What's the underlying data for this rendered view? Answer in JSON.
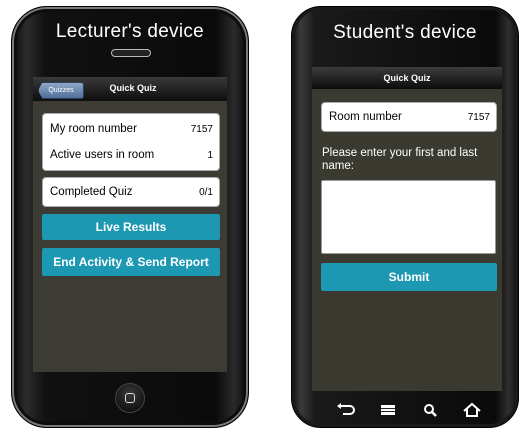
{
  "lecturer": {
    "caption": "Lecturer's device",
    "nav_back": "Quizzes",
    "nav_title": "Quick Quiz",
    "room_label": "My room number",
    "room_value": "7157",
    "active_label": "Active users in room",
    "active_value": "1",
    "completed_label": "Completed Quiz",
    "completed_value": "0/1",
    "live_results_button": "Live Results",
    "end_activity_button": "End Activity & Send Report"
  },
  "student": {
    "caption": "Student's device",
    "nav_title": "Quick Quiz",
    "room_label": "Room number",
    "room_value": "7157",
    "prompt": "Please enter your first and last name:",
    "name_value": "",
    "submit_button": "Submit"
  },
  "colors": {
    "accent": "#1c98b2",
    "screen_background": "#3d3c34",
    "back_button": "#5f7ea6"
  },
  "icons": {
    "lecturer_home": "home-button-icon",
    "student_softkeys": [
      "back-arrow-icon",
      "menu-icon",
      "search-icon",
      "home-icon"
    ]
  }
}
